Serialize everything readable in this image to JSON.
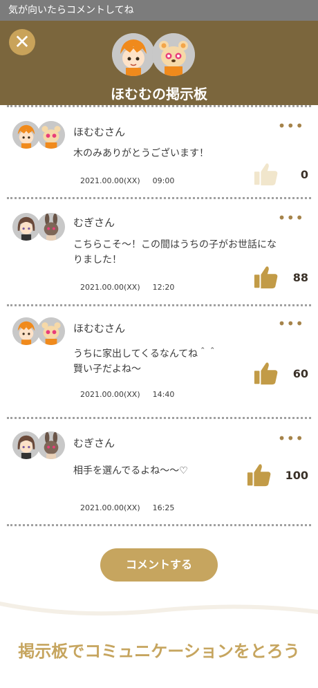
{
  "topbar": {
    "text": "気が向いたらコメントしてね"
  },
  "header": {
    "title": "ほむむの掲示板",
    "close_icon": "close-icon"
  },
  "posts": [
    {
      "name": "ほむむさん",
      "body": "木のみありがとうございます！",
      "date": "2021.00.00(XX)",
      "time": "09:00",
      "likes": "0",
      "liked": false
    },
    {
      "name": "むぎさん",
      "body": "こちらこそ〜！この間はうちの子がお世話になりました！",
      "date": "2021.00.00(XX)",
      "time": "12:20",
      "likes": "88",
      "liked": true
    },
    {
      "name": "ほむむさん",
      "body": "うちに家出してくるなんてね＾＾\n賢い子だよね〜",
      "date": "2021.00.00(XX)",
      "time": "14:40",
      "likes": "60",
      "liked": true
    },
    {
      "name": "むぎさん",
      "body": "相手を選んでるよね〜〜♡",
      "date": "2021.00.00(XX)",
      "time": "16:25",
      "likes": "100",
      "liked": true
    }
  ],
  "more_label": "•••",
  "comment_button": {
    "label": "コメントする"
  },
  "footer": {
    "text": "掲示板でコミュニケーションをとろう"
  },
  "colors": {
    "header": "#7b663d",
    "accent": "#c6a55f",
    "like_active": "#c29b47",
    "like_inactive": "#f1e6cc"
  }
}
